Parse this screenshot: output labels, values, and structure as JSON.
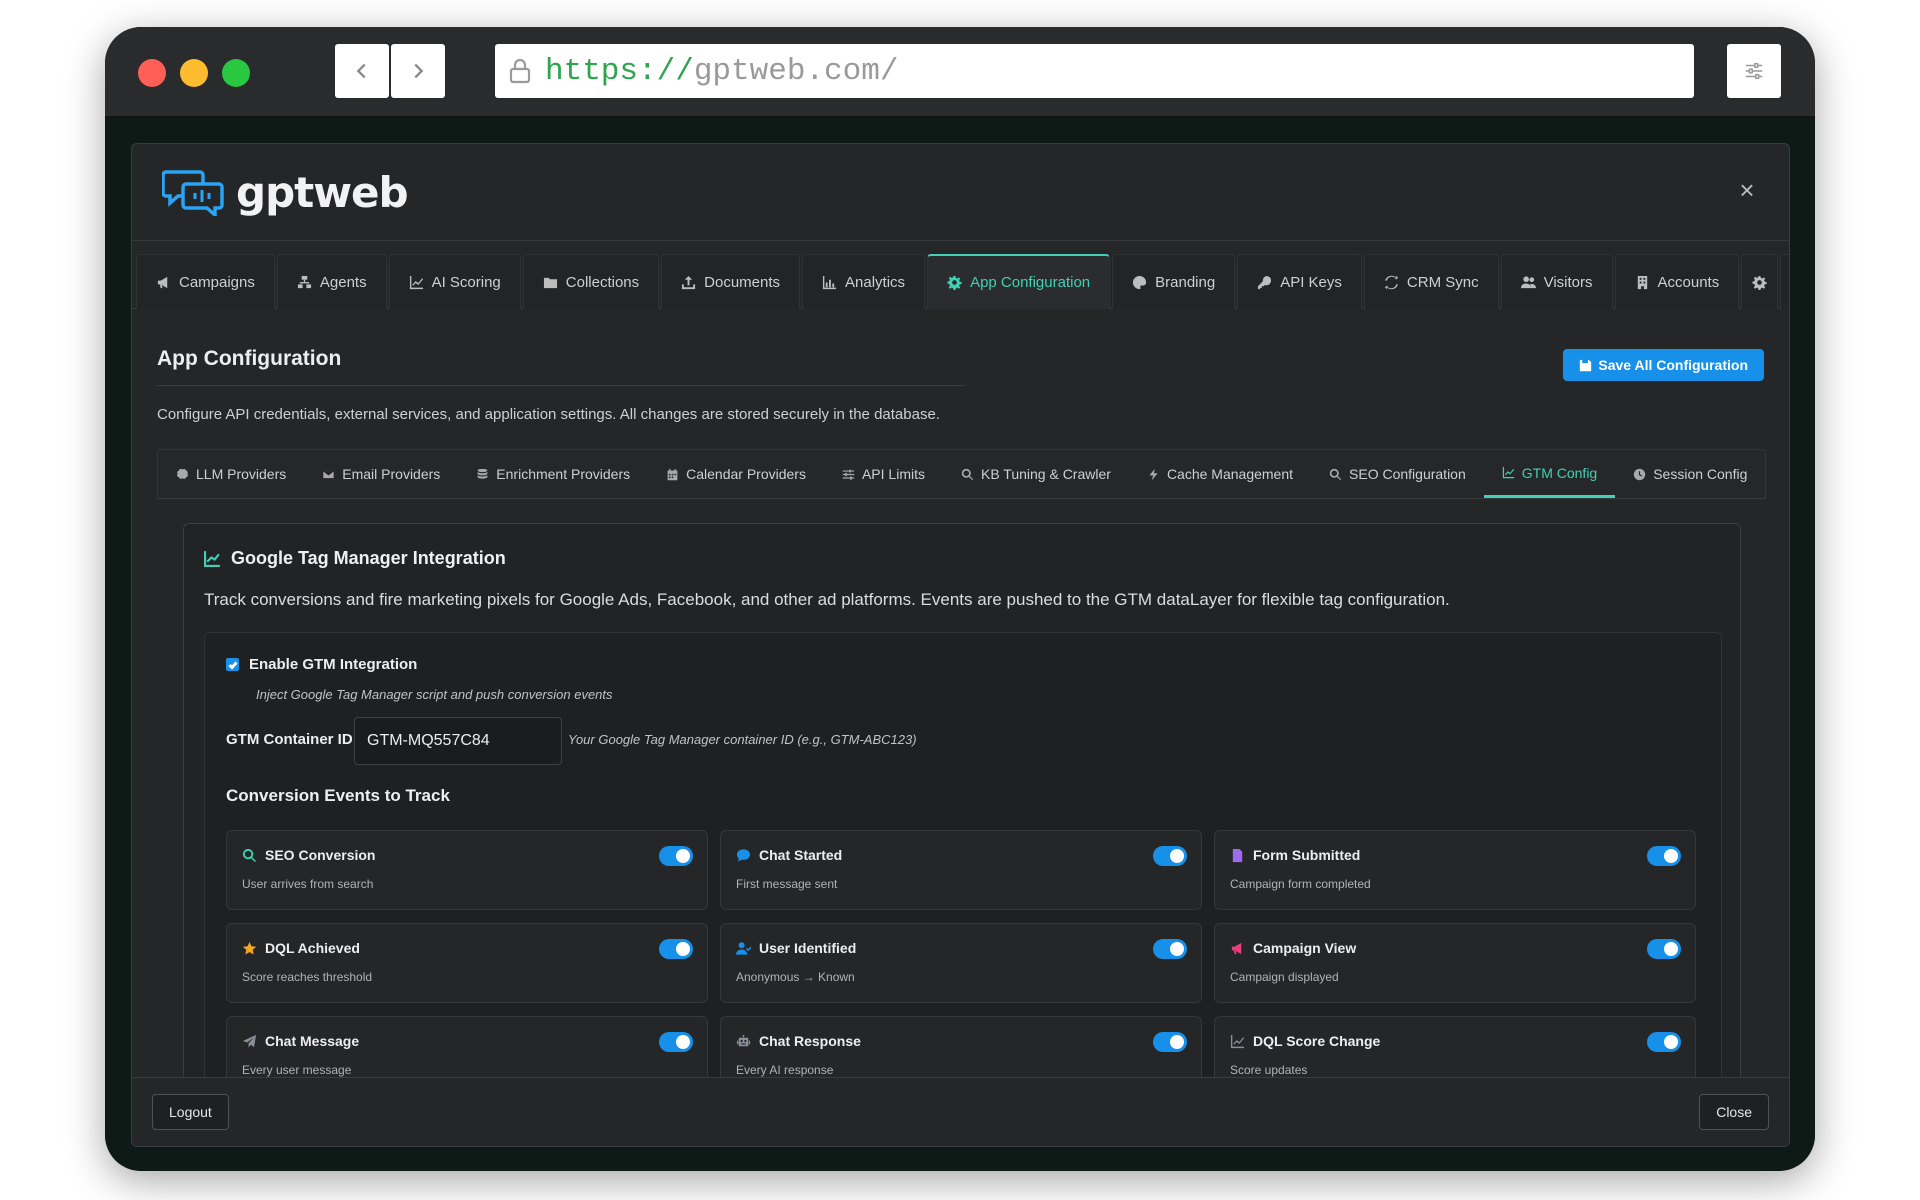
{
  "browser": {
    "url_scheme": "https://",
    "url_rest": "gptweb.com/"
  },
  "app": {
    "logo_text": "gptweb",
    "close_symbol": "×"
  },
  "main_tabs": [
    {
      "label": "Campaigns",
      "icon": "megaphone-icon"
    },
    {
      "label": "Agents",
      "icon": "agents-icon"
    },
    {
      "label": "AI Scoring",
      "icon": "chart-line-icon"
    },
    {
      "label": "Collections",
      "icon": "folder-icon"
    },
    {
      "label": "Documents",
      "icon": "upload-icon"
    },
    {
      "label": "Analytics",
      "icon": "chart-bar-icon"
    },
    {
      "label": "App Configuration",
      "icon": "gear-icon",
      "active": true
    },
    {
      "label": "Branding",
      "icon": "palette-icon"
    },
    {
      "label": "API Keys",
      "icon": "key-icon"
    },
    {
      "label": "CRM Sync",
      "icon": "sync-icon"
    },
    {
      "label": "Visitors",
      "icon": "users-icon"
    },
    {
      "label": "Accounts",
      "icon": "building-icon"
    }
  ],
  "page": {
    "title": "App Configuration",
    "description": "Configure API credentials, external services, and application settings. All changes are stored securely in the database.",
    "save_button": "Save All Configuration"
  },
  "sub_tabs": [
    {
      "label": "LLM Providers",
      "icon": "brain-icon"
    },
    {
      "label": "Email Providers",
      "icon": "envelope-icon"
    },
    {
      "label": "Enrichment Providers",
      "icon": "database-icon"
    },
    {
      "label": "Calendar Providers",
      "icon": "calendar-icon"
    },
    {
      "label": "API Limits",
      "icon": "sliders-icon"
    },
    {
      "label": "KB Tuning & Crawler",
      "icon": "search-icon"
    },
    {
      "label": "Cache Management",
      "icon": "bolt-icon"
    },
    {
      "label": "SEO Configuration",
      "icon": "search-icon"
    },
    {
      "label": "GTM Config",
      "icon": "chart-line-icon",
      "active": true
    },
    {
      "label": "Session Config",
      "icon": "clock-icon"
    }
  ],
  "gtm": {
    "title": "Google Tag Manager Integration",
    "description": "Track conversions and fire marketing pixels for Google Ads, Facebook, and other ad platforms. Events are pushed to the GTM dataLayer for flexible tag configuration.",
    "enable_label": "Enable GTM Integration",
    "enable_checked": true,
    "enable_help": "Inject Google Tag Manager script and push conversion events",
    "container_label": "GTM Container ID",
    "container_value": "GTM-MQ557C84",
    "container_help": "Your Google Tag Manager container ID (e.g., GTM-ABC123)",
    "events_title": "Conversion Events to Track"
  },
  "events": [
    {
      "name": "SEO Conversion",
      "sub": "User arrives from search",
      "icon": "search-icon",
      "color": "#3fd1b4",
      "enabled": true
    },
    {
      "name": "Chat Started",
      "sub": "First message sent",
      "icon": "chat-icon",
      "color": "#1690e8",
      "enabled": true
    },
    {
      "name": "Form Submitted",
      "sub": "Campaign form completed",
      "icon": "file-icon",
      "color": "#9b6cf0",
      "enabled": true
    },
    {
      "name": "DQL Achieved",
      "sub": "Score reaches threshold",
      "icon": "star-icon",
      "color": "#f5a623",
      "enabled": true
    },
    {
      "name": "User Identified",
      "sub": "Anonymous → Known",
      "icon": "user-check-icon",
      "color": "#1690e8",
      "enabled": true
    },
    {
      "name": "Campaign View",
      "sub": "Campaign displayed",
      "icon": "megaphone-icon",
      "color": "#e8417a",
      "enabled": true
    },
    {
      "name": "Chat Message",
      "sub": "Every user message",
      "icon": "paper-plane-icon",
      "color": "#8a8f98",
      "enabled": true
    },
    {
      "name": "Chat Response",
      "sub": "Every AI response",
      "icon": "robot-icon",
      "color": "#8a8f98",
      "enabled": true
    },
    {
      "name": "DQL Score Change",
      "sub": "Score updates",
      "icon": "chart-line-icon",
      "color": "#8a8f98",
      "enabled": true
    }
  ],
  "footer": {
    "logout": "Logout",
    "close": "Close"
  }
}
